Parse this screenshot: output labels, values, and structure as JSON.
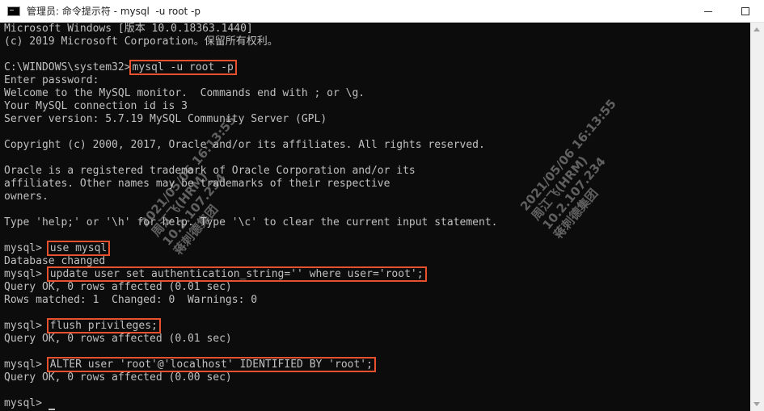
{
  "window": {
    "title": "管理员: 命令提示符 - mysql  -u root -p"
  },
  "terminal": {
    "lines": [
      {
        "text": "Microsoft Windows [版本 10.0.18363.1440]"
      },
      {
        "text": "(c) 2019 Microsoft Corporation。保留所有权利。"
      },
      {
        "text": ""
      },
      {
        "prompt": "C:\\WINDOWS\\system32>",
        "command": "mysql -u root -p"
      },
      {
        "text": "Enter password:"
      },
      {
        "text": "Welcome to the MySQL monitor.  Commands end with ; or \\g."
      },
      {
        "text": "Your MySQL connection id is 3"
      },
      {
        "text": "Server version: 5.7.19 MySQL Community Server (GPL)"
      },
      {
        "text": ""
      },
      {
        "text": "Copyright (c) 2000, 2017, Oracle and/or its affiliates. All rights reserved."
      },
      {
        "text": ""
      },
      {
        "text": "Oracle is a registered trademark of Oracle Corporation and/or its"
      },
      {
        "text": "affiliates. Other names may be trademarks of their respective"
      },
      {
        "text": "owners."
      },
      {
        "text": ""
      },
      {
        "text": "Type 'help;' or '\\h' for help. Type '\\c' to clear the current input statement."
      },
      {
        "text": ""
      },
      {
        "prompt": "mysql> ",
        "command": "use mysql"
      },
      {
        "text": "Database changed"
      },
      {
        "prompt": "mysql> ",
        "command": "update user set authentication_string='' where user='root';"
      },
      {
        "text": "Query OK, 0 rows affected (0.01 sec)"
      },
      {
        "text": "Rows matched: 1  Changed: 0  Warnings: 0"
      },
      {
        "text": ""
      },
      {
        "prompt": "mysql> ",
        "command": "flush privileges;"
      },
      {
        "text": "Query OK, 0 rows affected (0.01 sec)"
      },
      {
        "text": ""
      },
      {
        "prompt": "mysql> ",
        "command": "ALTER user 'root'@'localhost' IDENTIFIED BY 'root';"
      },
      {
        "text": "Query OK, 0 rows affected (0.00 sec)"
      },
      {
        "text": ""
      },
      {
        "prompt": "mysql> ",
        "command": "",
        "cursor": true
      }
    ]
  },
  "watermarks": [
    {
      "lines": [
        "2021/05/06 16:13:55",
        "周江飞(HRM)",
        "10.2.107.234",
        "蒋刺德集团"
      ]
    },
    {
      "lines": [
        "2021/05/06 16:13:55",
        "周江飞(HRM)",
        "10.2.107.234",
        "蒋刺德集团"
      ]
    }
  ],
  "colors": {
    "highlight": "#e8512e",
    "terminal_text": "#c0c0c0",
    "terminal_bg": "#0c0c0c"
  }
}
